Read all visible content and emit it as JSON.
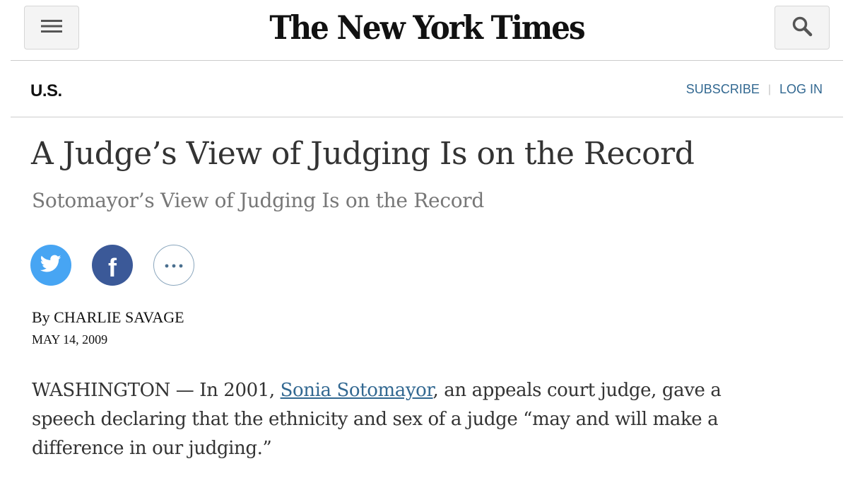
{
  "masthead": {
    "logo_text": "The New York Times",
    "menu_icon": "hamburger-menu-icon",
    "search_icon": "search-icon"
  },
  "section": {
    "name": "U.S.",
    "subscribe_label": "SUBSCRIBE",
    "separator": "|",
    "login_label": "LOG IN"
  },
  "article": {
    "headline": "A Judge’s View of Judging Is on the Record",
    "subheadline": "Sotomayor’s View of Judging Is on the Record",
    "byline": "By CHARLIE SAVAGE",
    "date": "MAY 14, 2009",
    "body": {
      "lead": "WASHINGTON — In 2001, ",
      "link_text": "Sonia Sotomayor",
      "rest": ", an appeals court judge, gave a speech declaring that the ethnicity and sex of a judge “may and will make a difference in our judging.”"
    }
  },
  "share": {
    "twitter_icon": "twitter-bird-icon",
    "facebook_icon": "facebook-icon",
    "facebook_glyph": "f",
    "more_icon": "ellipsis-icon"
  },
  "colors": {
    "link": "#326891",
    "twitter": "#47a5f3",
    "facebook": "#3b5998",
    "text": "#333333",
    "subhead": "#777777"
  }
}
